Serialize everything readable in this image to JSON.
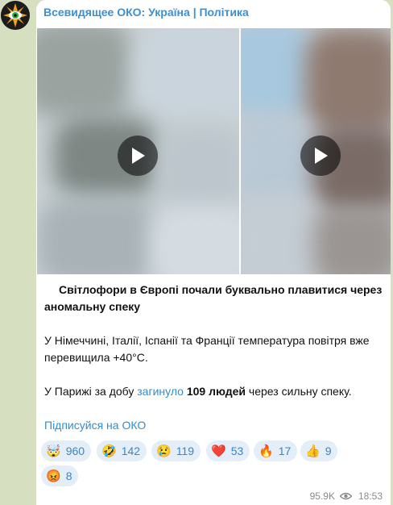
{
  "channel": {
    "name": "Всевидящее ОКО: Україна | Політика"
  },
  "post": {
    "headline": "Світлофори в Європі почали буквально плавитися через аномальну спеку",
    "paragraph1": "У Німеччині, Італії, Іспанії та Франції температура повітря вже перевищила +40°C.",
    "p2_before": "У Парижі за добу ",
    "p2_link": "загинуло",
    "p2_bold": "109 людей",
    "p2_after": " через сильну спеку.",
    "subscribe": "Підписуйся на ОКО"
  },
  "reactions": [
    {
      "icon": "exploding-head-icon",
      "emoji": "🤯",
      "count": "960"
    },
    {
      "icon": "rofl-icon",
      "emoji": "🤣",
      "count": "142"
    },
    {
      "icon": "crying-face-icon",
      "emoji": "😢",
      "count": "119"
    },
    {
      "icon": "red-heart-icon",
      "emoji": "❤️",
      "count": "53"
    },
    {
      "icon": "fire-icon",
      "emoji": "🔥",
      "count": "17"
    },
    {
      "icon": "thumbs-up-icon",
      "emoji": "👍",
      "count": "9"
    },
    {
      "icon": "enraged-face-icon",
      "emoji": "😡",
      "count": "8"
    }
  ],
  "meta": {
    "views": "95.9K",
    "time": "18:53"
  },
  "colors": {
    "link": "#2f8ed3",
    "reaction_bg": "#e3eef9",
    "chat_bg": "#d7dfc1"
  }
}
